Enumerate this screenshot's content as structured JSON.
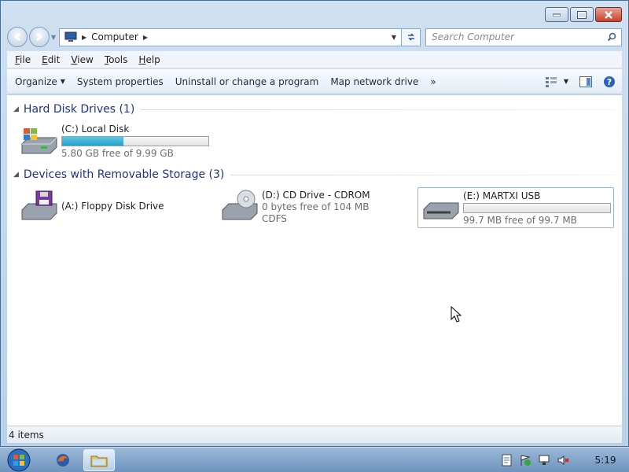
{
  "window": {
    "caption_buttons": [
      "minimize-icon",
      "maximize-icon",
      "close-icon"
    ]
  },
  "address": {
    "crumbs": [
      "Computer"
    ],
    "search_placeholder": "Search Computer"
  },
  "menu": {
    "items": [
      "File",
      "Edit",
      "View",
      "Tools",
      "Help"
    ]
  },
  "commands": {
    "organize": "Organize",
    "system_properties": "System properties",
    "uninstall": "Uninstall or change a program",
    "map_drive": "Map network drive",
    "more": "»"
  },
  "groups": {
    "hdd": {
      "title": "Hard Disk Drives (1)"
    },
    "removable": {
      "title": "Devices with Removable Storage (3)"
    }
  },
  "drives": {
    "c": {
      "name": "(C:) Local Disk",
      "free": "5.80 GB free of 9.99 GB",
      "used_fraction": 0.42
    },
    "a": {
      "name": "(A:) Floppy Disk Drive"
    },
    "d": {
      "name": "(D:) CD Drive - CDROM",
      "free": "0 bytes free of 104 MB",
      "fs": "CDFS"
    },
    "e": {
      "name": "(E:) MARTXI USB",
      "free": "99.7 MB free of 99.7 MB",
      "used_fraction": 0.0
    }
  },
  "status": {
    "items": "4 items"
  },
  "taskbar": {
    "clock": "5:19",
    "colors": {
      "accent": "#2a9ec8",
      "group_header": "#1e3287"
    }
  }
}
